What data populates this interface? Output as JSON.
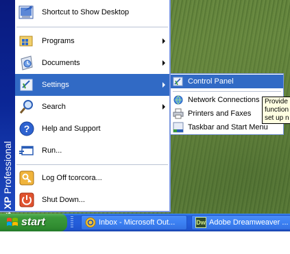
{
  "start_menu": {
    "brand": {
      "product": "Windows XP",
      "edition": "Professional"
    },
    "items": [
      {
        "id": "show-desktop",
        "label": "Shortcut to Show Desktop",
        "icon": "show-desktop-icon"
      },
      {
        "id": "programs",
        "label": "Programs",
        "icon": "programs-icon",
        "submenu": true
      },
      {
        "id": "documents",
        "label": "Documents",
        "icon": "documents-icon",
        "submenu": true
      },
      {
        "id": "settings",
        "label": "Settings",
        "icon": "settings-icon",
        "submenu": true,
        "active": true
      },
      {
        "id": "search",
        "label": "Search",
        "icon": "search-icon",
        "submenu": true
      },
      {
        "id": "help",
        "label": "Help and Support",
        "icon": "help-icon"
      },
      {
        "id": "run",
        "label": "Run...",
        "icon": "run-icon"
      },
      {
        "id": "logoff",
        "label": "Log Off tcorcora...",
        "icon": "logoff-icon"
      },
      {
        "id": "shutdown",
        "label": "Shut Down...",
        "icon": "shutdown-icon"
      }
    ]
  },
  "settings_submenu": {
    "items": [
      {
        "id": "control-panel",
        "label": "Control Panel",
        "icon": "control-panel-icon",
        "active": true
      },
      {
        "id": "network-connections",
        "label": "Network Connections",
        "icon": "network-connections-icon",
        "submenu": true
      },
      {
        "id": "printers-faxes",
        "label": "Printers and Faxes",
        "icon": "printers-icon"
      },
      {
        "id": "taskbar-start-menu",
        "label": "Taskbar and Start Menu",
        "icon": "taskbar-icon"
      }
    ]
  },
  "tooltip": {
    "lines": [
      "Provide",
      "function",
      "set up n"
    ]
  },
  "taskbar": {
    "start_label": "start",
    "tasks": [
      {
        "label": "Inbox - Microsoft Out...",
        "icon": "outlook-icon"
      },
      {
        "label": "Adobe Dreamweaver ...",
        "icon": "dreamweaver-icon",
        "icon_text": "Dw"
      }
    ]
  },
  "colors": {
    "highlight": "#316ac5",
    "taskbar": "#245edb",
    "start_button": "#3c9b3c",
    "brand_bar": "#0b2797"
  }
}
